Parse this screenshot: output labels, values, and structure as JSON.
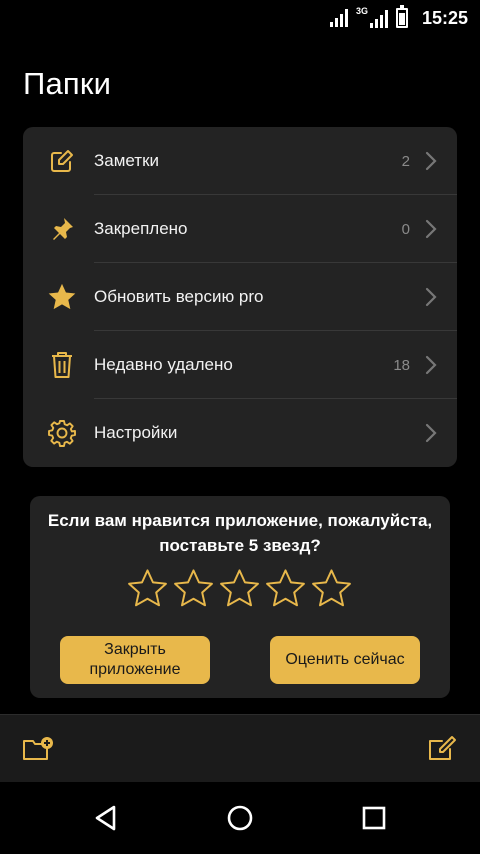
{
  "status_bar": {
    "network_type": "3G",
    "time": "15:25"
  },
  "page": {
    "title": "Папки"
  },
  "folders": [
    {
      "label": "Заметки",
      "count": "2",
      "icon": "note-edit-icon"
    },
    {
      "label": "Закреплено",
      "count": "0",
      "icon": "pin-icon"
    },
    {
      "label": "Обновить версию pro",
      "count": "",
      "icon": "star-icon"
    },
    {
      "label": "Недавно удалено",
      "count": "18",
      "icon": "trash-icon"
    },
    {
      "label": "Настройки",
      "count": "",
      "icon": "gear-icon"
    }
  ],
  "rate_dialog": {
    "text_line1": "Если вам нравится приложение, пожалуйста,",
    "text_line2": "поставьте 5 звезд?",
    "stars_total": 5,
    "stars_filled": 0,
    "close_label_line1": "Закрыть",
    "close_label_line2": "приложение",
    "rate_label": "Оценить сейчас"
  },
  "toolbar": {
    "left_icon": "new-folder-icon",
    "right_icon": "compose-icon"
  },
  "nav": [
    "back-icon",
    "home-icon",
    "recents-icon"
  ],
  "colors": {
    "accent": "#e8b84b",
    "background": "#000000",
    "card": "#232323"
  }
}
